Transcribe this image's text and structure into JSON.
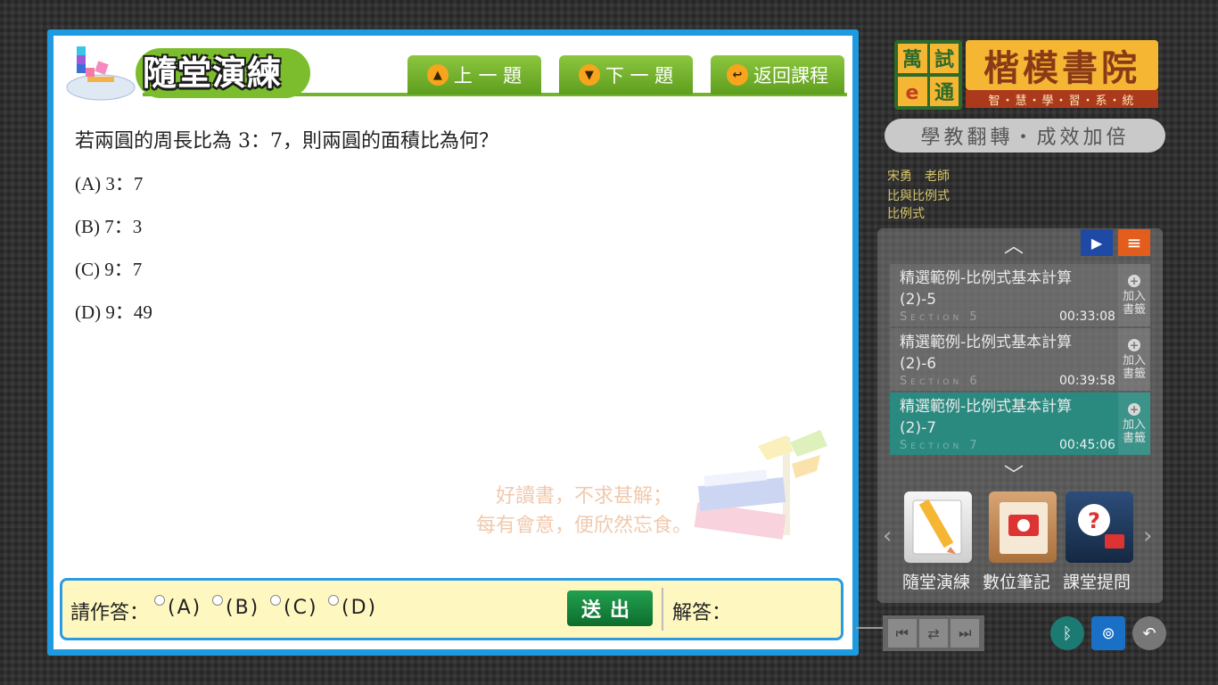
{
  "quiz": {
    "title": "隨堂演練",
    "prev_label": "上 一 題",
    "next_label": "下 一 題",
    "back_label": "返回課程",
    "question": "若兩圓的周長比為 3：7，則兩圓的面積比為何？",
    "options": [
      {
        "key": "A",
        "text": "(A) 3：7"
      },
      {
        "key": "B",
        "text": "(B) 7：3"
      },
      {
        "key": "C",
        "text": "(C) 9：7"
      },
      {
        "key": "D",
        "text": "(D) 9：49"
      }
    ],
    "watermark_lines": [
      "好讀書，不求甚解；",
      "每有會意，便欣然忘食。"
    ],
    "answer_prompt": "請作答：",
    "radio_labels": [
      "(A)",
      "(B)",
      "(C)",
      "(D)"
    ],
    "submit_label": "送出",
    "solution_label": "解答："
  },
  "brand": {
    "logo_chars": "萬試通",
    "name": "楷模書院",
    "tagline": "智・慧・學・習・系・統",
    "slogan": "學教翻轉・成效加倍"
  },
  "course": {
    "teacher": "宋勇　老師",
    "chapter": "比與比例式",
    "topic": "比例式"
  },
  "playlist": {
    "lessons": [
      {
        "title": "精選範例-比例式基本計算(2)-5",
        "section": "Section 5",
        "time": "00:33:08",
        "bookmark": [
          "加入",
          "書籤"
        ],
        "active": false
      },
      {
        "title": "精選範例-比例式基本計算(2)-6",
        "section": "Section 6",
        "time": "00:39:58",
        "bookmark": [
          "加入",
          "書籤"
        ],
        "active": false
      },
      {
        "title": "精選範例-比例式基本計算(2)-7",
        "section": "Section 7",
        "time": "00:45:06",
        "bookmark": [
          "加入",
          "書籤"
        ],
        "active": true
      }
    ]
  },
  "tools": {
    "practice": "隨堂演練",
    "notes": "數位筆記",
    "question": "課堂提問"
  },
  "colors": {
    "accent_blue": "#1e9be0",
    "accent_green": "#72b52b",
    "active_lesson": "#2b8a80",
    "answer_bg": "#fef8c0"
  }
}
